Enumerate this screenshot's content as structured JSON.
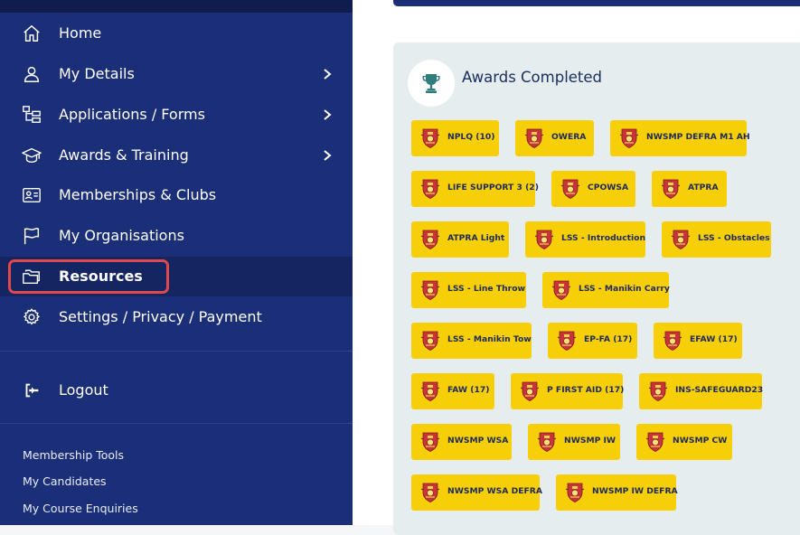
{
  "sidebar": {
    "nav": [
      {
        "label": "Home",
        "icon": "home-icon",
        "chevron": false,
        "active": false
      },
      {
        "label": "My Details",
        "icon": "user-icon",
        "chevron": true,
        "active": false
      },
      {
        "label": "Applications / Forms",
        "icon": "sitemap-icon",
        "chevron": true,
        "active": false
      },
      {
        "label": "Awards & Training",
        "icon": "graduation-cap-icon",
        "chevron": true,
        "active": false
      },
      {
        "label": "Memberships & Clubs",
        "icon": "id-card-icon",
        "chevron": false,
        "active": false
      },
      {
        "label": "My Organisations",
        "icon": "flag-icon",
        "chevron": false,
        "active": false
      },
      {
        "label": "Resources",
        "icon": "folders-icon",
        "chevron": false,
        "active": true
      },
      {
        "label": "Settings / Privacy / Payment",
        "icon": "gear-icon",
        "chevron": false,
        "active": false
      }
    ],
    "logout_label": "Logout",
    "tools": [
      "Membership Tools",
      "My Candidates",
      "My Course Enquiries"
    ]
  },
  "awards": {
    "title": "Awards Completed",
    "icon": "trophy-icon",
    "items": [
      "NPLQ (10)",
      "OWERA",
      "NWSMP DEFRA M1 AH",
      "LIFE SUPPORT 3 (2)",
      "CPOWSA",
      "ATPRA",
      "ATPRA Light",
      "LSS - Introduction",
      "LSS - Obstacles",
      "LSS - Line Throw",
      "LSS - Manikin Carry",
      "LSS - Manikin Tow",
      "EP-FA (17)",
      "EFAW (17)",
      "FAW (17)",
      "P FIRST AID (17)",
      "INS-SAFEGUARD23",
      "NWSMP WSA",
      "NWSMP IW",
      "NWSMP CW",
      "NWSMP WSA DEFRA",
      "NWSMP IW DEFRA"
    ]
  },
  "colors": {
    "sidebar_bg": "#1b2f78",
    "badge_bg": "#f7cf08",
    "highlight": "#e2474c",
    "card_bg": "#e6edee"
  }
}
